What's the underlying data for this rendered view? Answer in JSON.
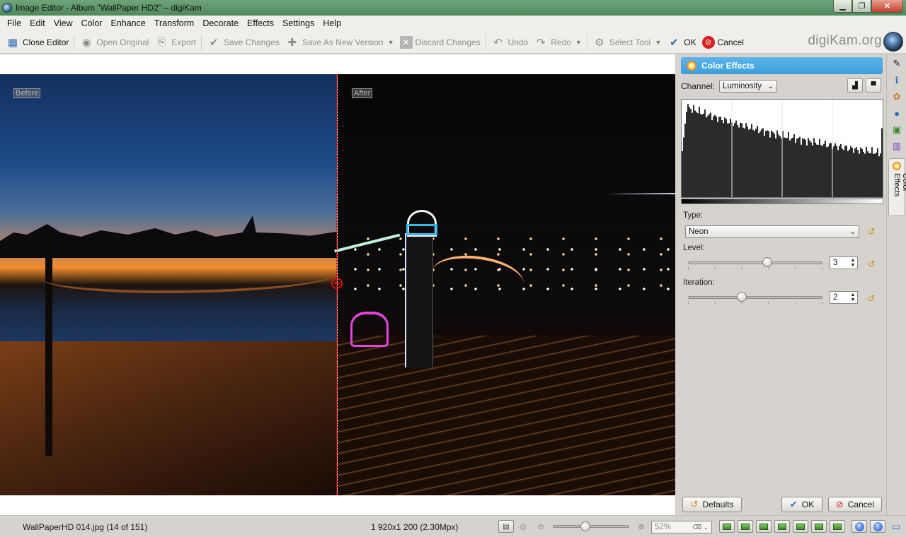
{
  "window": {
    "title": "Image Editor - Album \"WallPaper HD2\" – digiKam"
  },
  "menu": {
    "items": [
      "File",
      "Edit",
      "View",
      "Color",
      "Enhance",
      "Transform",
      "Decorate",
      "Effects",
      "Settings",
      "Help"
    ]
  },
  "toolbar": {
    "close_editor": "Close Editor",
    "open_original": "Open Original",
    "export": "Export",
    "save_changes": "Save Changes",
    "save_as_new_version": "Save As New Version",
    "discard_changes": "Discard Changes",
    "undo": "Undo",
    "redo": "Redo",
    "select_tool": "Select Tool",
    "ok": "OK",
    "cancel": "Cancel",
    "brand": "digiKam.org"
  },
  "canvas": {
    "before_label": "Before",
    "after_label": "After"
  },
  "panel": {
    "title": "Color Effects",
    "channel_label": "Channel:",
    "channel_value": "Luminosity",
    "type_label": "Type:",
    "type_value": "Neon",
    "level_label": "Level:",
    "level_value": "3",
    "level_position": 0.59,
    "iteration_label": "Iteration:",
    "iteration_value": "2",
    "iteration_position": 0.4,
    "defaults_button": "Defaults",
    "ok_button": "OK",
    "cancel_button": "Cancel",
    "vertical_tab_label": "Color Effects"
  },
  "status": {
    "file": "WallPaperHD 014.jpg (14 of 151)",
    "dimensions": "1 920x1 200 (2.30Mpx)",
    "zoom_value": "52%",
    "zoom_position": 0.36
  },
  "colors": {
    "panel_header": "#3c9fdc",
    "split_line": "#e01010",
    "title_bar": "#4f8a5c"
  }
}
